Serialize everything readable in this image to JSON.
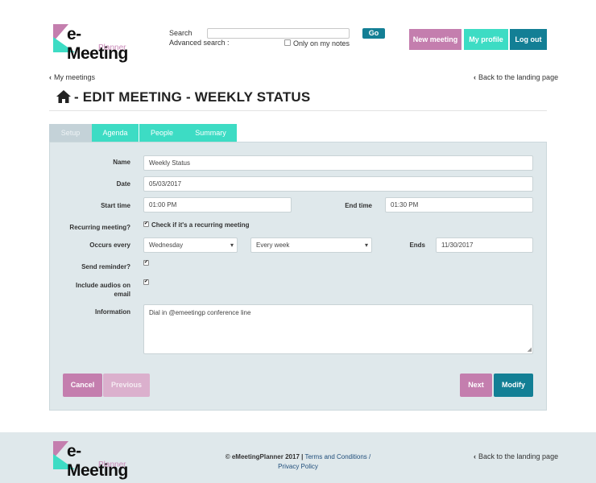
{
  "header": {
    "logo_brand": "e-Meeting",
    "logo_sub": "Planner",
    "search_label": "Search",
    "search_value": "",
    "advanced_search_label": "Advanced search :",
    "go_label": "Go",
    "only_notes_label": "Only on my notes",
    "new_meeting_label": "New meeting",
    "my_profile_label": "My profile",
    "log_out_label": "Log out"
  },
  "nav": {
    "my_meetings": "My meetings",
    "back_landing": "Back to the landing page"
  },
  "page": {
    "title": "- EDIT MEETING - WEEKLY STATUS"
  },
  "tabs": [
    "Setup",
    "Agenda",
    "People",
    "Summary"
  ],
  "form": {
    "name_label": "Name",
    "name_value": "Weekly Status",
    "date_label": "Date",
    "date_value": "05/03/2017",
    "start_time_label": "Start time",
    "start_time_value": "01:00 PM",
    "end_time_label": "End time",
    "end_time_value": "01:30 PM",
    "recurring_label": "Recurring meeting?",
    "recurring_check_text": "Check if it's a recurring meeting",
    "recurring_checked": true,
    "occurs_label": "Occurs every",
    "occurs_day": "Wednesday",
    "occurs_frequency": "Every week",
    "ends_label": "Ends",
    "ends_value": "11/30/2017",
    "reminder_label": "Send reminder?",
    "reminder_checked": true,
    "audios_label_line1": "Include audios on",
    "audios_label_line2": "email",
    "audios_checked": true,
    "info_label": "Information",
    "info_value": "Dial in @emeetingp conference line"
  },
  "buttons": {
    "cancel": "Cancel",
    "previous": "Previous",
    "next": "Next",
    "modify": "Modify"
  },
  "footer": {
    "copyright": "© eMeetingPlanner 2017 |",
    "terms": "Terms and Conditions /",
    "privacy": "Privacy Policy",
    "back_landing": "Back to the landing page"
  },
  "colors": {
    "primary_teal": "#137f95",
    "accent_pink": "#c47eae",
    "accent_mint": "#3ddcc4",
    "panel_bg": "#dfe8eb"
  },
  "icons": {
    "check": "✔",
    "chevron": "‹",
    "home": "home-icon"
  }
}
